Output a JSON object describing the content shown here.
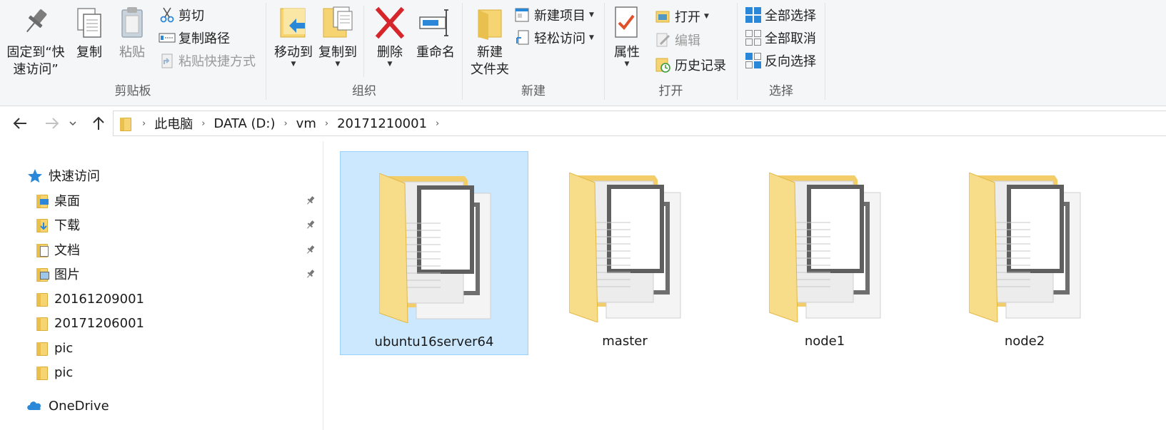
{
  "ribbon": {
    "clipboard": {
      "label": "剪贴板",
      "pin_label_1": "固定到“快",
      "pin_label_2": "速访问”",
      "copy_label": "复制",
      "paste_label": "粘贴",
      "cut_label": "剪切",
      "copy_path_label": "复制路径",
      "paste_shortcut_label": "粘贴快捷方式"
    },
    "organize": {
      "label": "组织",
      "move_to_label": "移动到",
      "copy_to_label": "复制到",
      "delete_label": "删除",
      "rename_label": "重命名"
    },
    "new": {
      "label": "新建",
      "new_folder_label_1": "新建",
      "new_folder_label_2": "文件夹",
      "new_item_label": "新建项目",
      "easy_access_label": "轻松访问"
    },
    "open": {
      "label": "打开",
      "properties_label": "属性",
      "open_label": "打开",
      "edit_label": "编辑",
      "history_label": "历史记录"
    },
    "select": {
      "label": "选择",
      "select_all_label": "全部选择",
      "select_none_label": "全部取消",
      "invert_label": "反向选择"
    }
  },
  "address": {
    "crumbs": [
      "此电脑",
      "DATA (D:)",
      "vm",
      "20171210001"
    ]
  },
  "nav": {
    "quick_access": "快速访问",
    "items": [
      {
        "label": "桌面",
        "icon": "desktop-folder-icon",
        "pinned": true
      },
      {
        "label": "下载",
        "icon": "downloads-folder-icon",
        "pinned": true
      },
      {
        "label": "文档",
        "icon": "documents-folder-icon",
        "pinned": true
      },
      {
        "label": "图片",
        "icon": "pictures-folder-icon",
        "pinned": true
      },
      {
        "label": "20161209001",
        "icon": "folder-icon",
        "pinned": false
      },
      {
        "label": "20171206001",
        "icon": "folder-icon",
        "pinned": false
      },
      {
        "label": "pic",
        "icon": "folder-icon",
        "pinned": false
      },
      {
        "label": "pic",
        "icon": "folder-icon",
        "pinned": false
      }
    ],
    "onedrive": "OneDrive"
  },
  "content": {
    "folders": [
      {
        "name": "ubuntu16server64",
        "selected": true
      },
      {
        "name": "master",
        "selected": false
      },
      {
        "name": "node1",
        "selected": false
      },
      {
        "name": "node2",
        "selected": false
      }
    ]
  },
  "colors": {
    "selection_bg": "#cce8ff",
    "selection_border": "#99d1ff",
    "folder_yellow": "#f5d471",
    "accent_blue": "#2b87d8",
    "delete_red": "#d7262b"
  }
}
